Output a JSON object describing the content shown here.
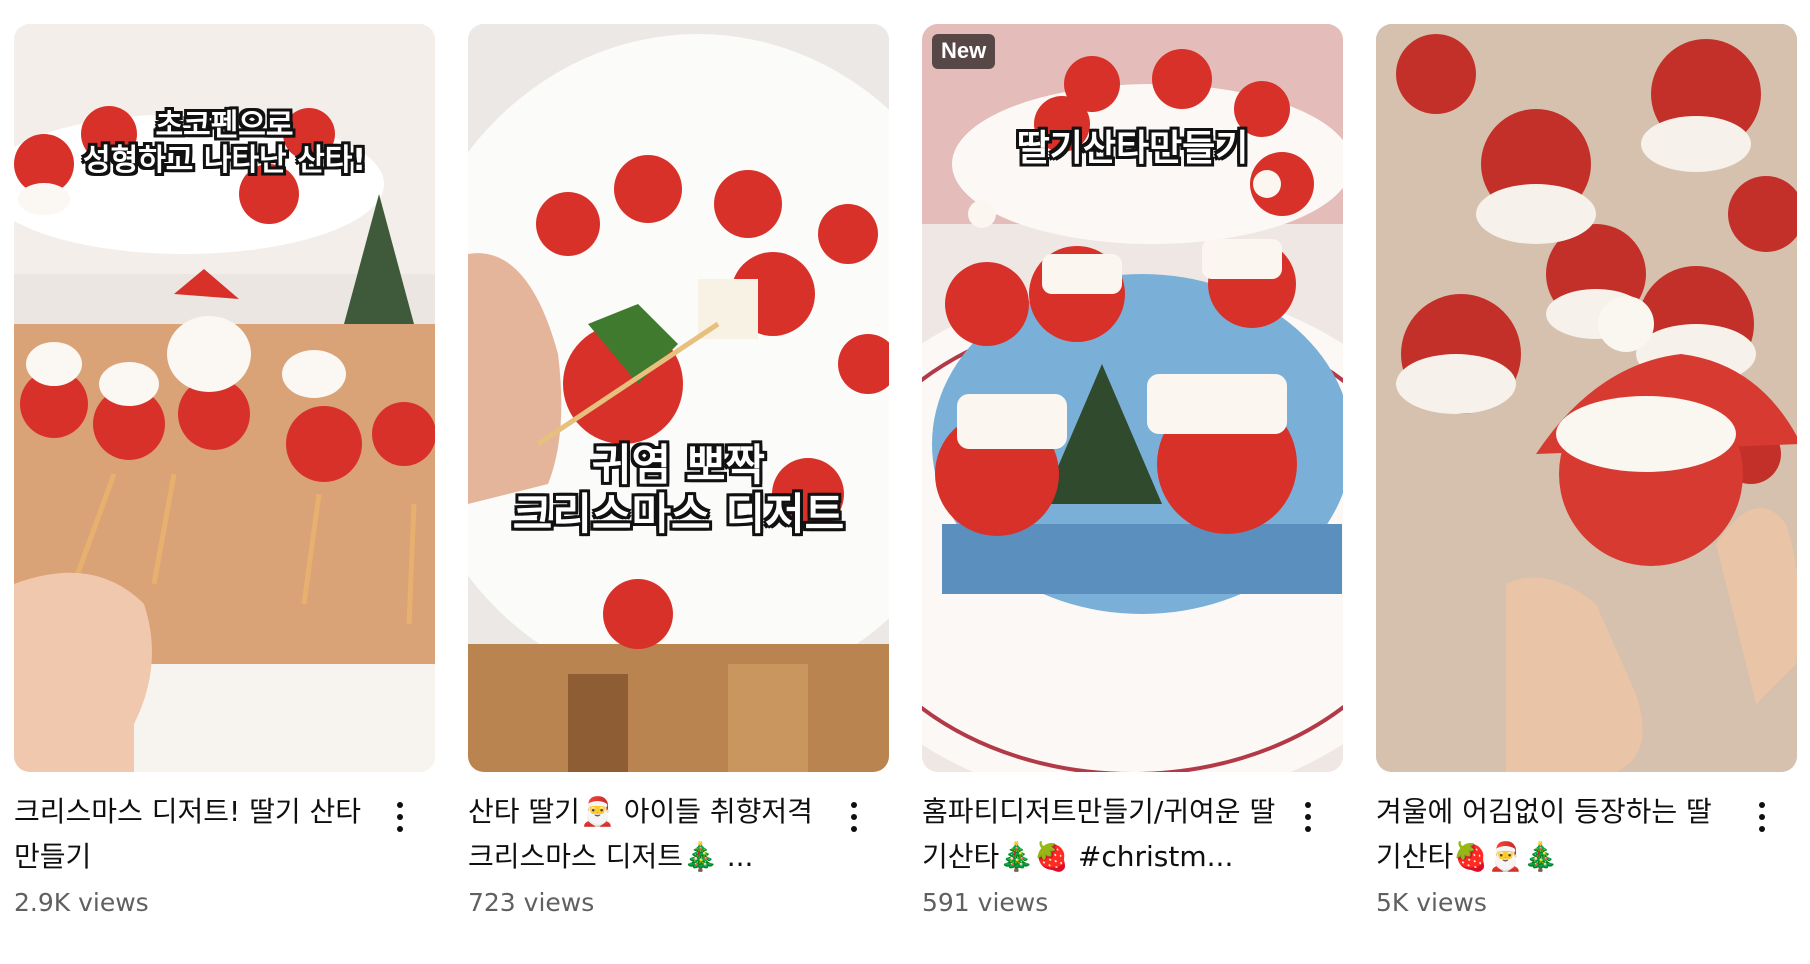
{
  "videos": [
    {
      "caption": "초코펜으로\n성형하고 나타난 산타!",
      "title": "크리스마스 디저트! 딸기 산타 만들기",
      "views": "2.9K views",
      "badge": ""
    },
    {
      "caption": "귀염 뽀짝\n크리스마스 디저트",
      "title": "산타 딸기🎅  아이들 취향저격 크리스마스 디저트🎄 ...",
      "views": "723 views",
      "badge": ""
    },
    {
      "caption": "딸기산타만들기",
      "title": "홈파티디저트만들기/귀여운 딸기산타🎄🍓 #christm...",
      "views": "591 views",
      "badge": "New"
    },
    {
      "caption": "",
      "title": "겨울에 어김없이 등장하는 딸기산타🍓🎅🎄",
      "views": "5K views",
      "badge": ""
    }
  ],
  "icons": {
    "more": "more-vert-icon"
  },
  "colors": {
    "title": "#0f0f0f",
    "views": "#606060",
    "strawberry": "#d8312a"
  }
}
